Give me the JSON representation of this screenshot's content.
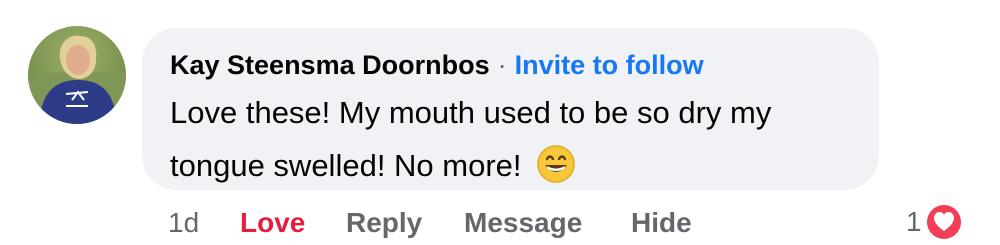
{
  "comment": {
    "author": "Kay Steensma Doornbos",
    "separator": "·",
    "follow_label": "Invite to follow",
    "text": "Love these! My mouth used to be so dry my tongue swelled! No more!",
    "emoji": "grinning-face-emoji"
  },
  "actions": {
    "time": "1d",
    "love": "Love",
    "reply": "Reply",
    "message": "Message",
    "hide": "Hide"
  },
  "reactions": {
    "count": "1",
    "type": "love-heart-icon",
    "color": "#f33e58"
  },
  "colors": {
    "bubble": "#f0f2f5",
    "link": "#1877f2",
    "love": "#e41e3f",
    "muted": "#65676b"
  }
}
